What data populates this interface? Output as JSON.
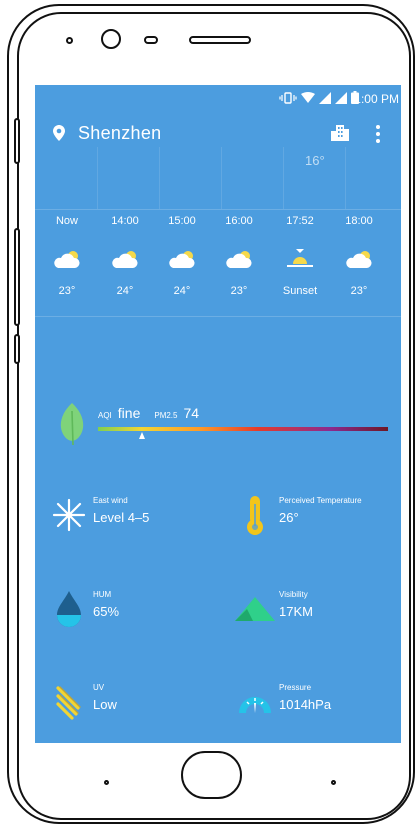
{
  "status": {
    "time": "1:00 PM"
  },
  "header": {
    "city": "Shenzhen"
  },
  "mini_chart": {
    "temp": "16°"
  },
  "hourly": [
    {
      "time": "Now",
      "temp": "23°",
      "icon": "partly-cloudy-icon"
    },
    {
      "time": "14:00",
      "temp": "24°",
      "icon": "partly-cloudy-icon"
    },
    {
      "time": "15:00",
      "temp": "24°",
      "icon": "partly-cloudy-icon"
    },
    {
      "time": "16:00",
      "temp": "23°",
      "icon": "partly-cloudy-icon"
    },
    {
      "time": "17:52",
      "temp": "Sunset",
      "icon": "sunset-icon"
    },
    {
      "time": "18:00",
      "temp": "23°",
      "icon": "partly-cloudy-icon"
    }
  ],
  "aqi": {
    "label": "AQI",
    "quality": "fine",
    "pm_label": "PM2.5",
    "pm_value": "74",
    "level_fraction": 0.15
  },
  "details": {
    "wind": {
      "label": "East wind",
      "value": "Level 4–5"
    },
    "perceived": {
      "label": "Perceived Temperature",
      "value": "26°"
    },
    "humidity": {
      "label": "HUM",
      "value": "65%"
    },
    "visibility": {
      "label": "Visibility",
      "value": "17KM"
    },
    "uv": {
      "label": "UV",
      "value": "Low"
    },
    "pressure": {
      "label": "Pressure",
      "value": "1014hPa"
    }
  },
  "colors": {
    "screen_bg": "#4c9ddf",
    "leaf": "#7fd37a",
    "thermometer": "#f2c51b",
    "water": "#25c3e8",
    "mountain": "#2fd08a",
    "uv": "#f2d534",
    "gauge": "#25c3e8"
  }
}
